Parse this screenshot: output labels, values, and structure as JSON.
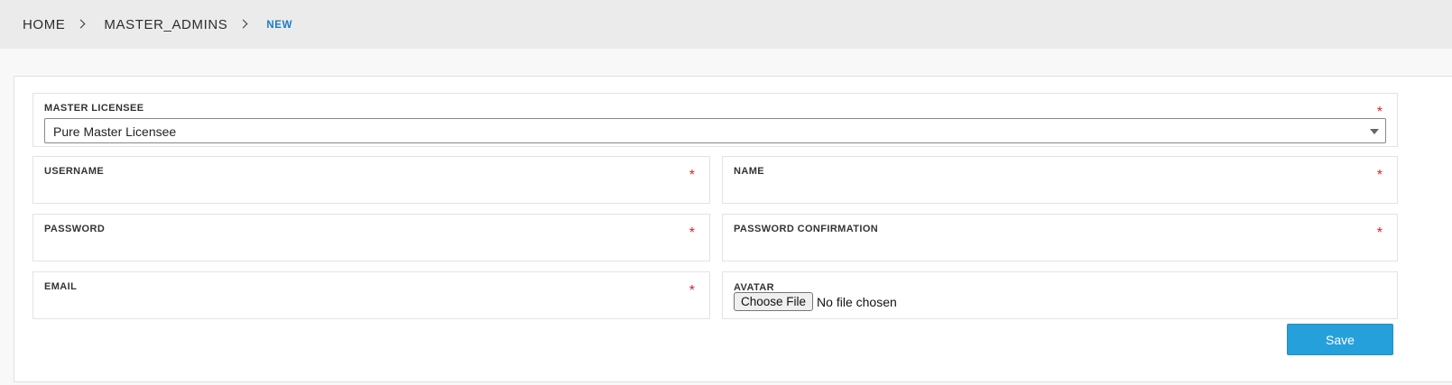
{
  "breadcrumb": {
    "home": "HOME",
    "section": "MASTER_ADMINS",
    "current": "NEW"
  },
  "form": {
    "master_licensee": {
      "label": "MASTER LICENSEE",
      "required": "*",
      "selected": "Pure Master Licensee"
    },
    "username": {
      "label": "USERNAME",
      "required": "*",
      "value": ""
    },
    "name": {
      "label": "NAME",
      "required": "*",
      "value": ""
    },
    "password": {
      "label": "PASSWORD",
      "required": "*",
      "value": ""
    },
    "password_confirmation": {
      "label": "PASSWORD CONFIRMATION",
      "required": "*",
      "value": ""
    },
    "email": {
      "label": "EMAIL",
      "required": "*",
      "value": ""
    },
    "avatar": {
      "label": "AVATAR",
      "button_label": "Choose File",
      "status": "No file chosen"
    },
    "save_label": "Save"
  },
  "colors": {
    "accent": "#26a0da",
    "breadcrumb_current": "#1b7bc6",
    "required": "#d9232e"
  }
}
